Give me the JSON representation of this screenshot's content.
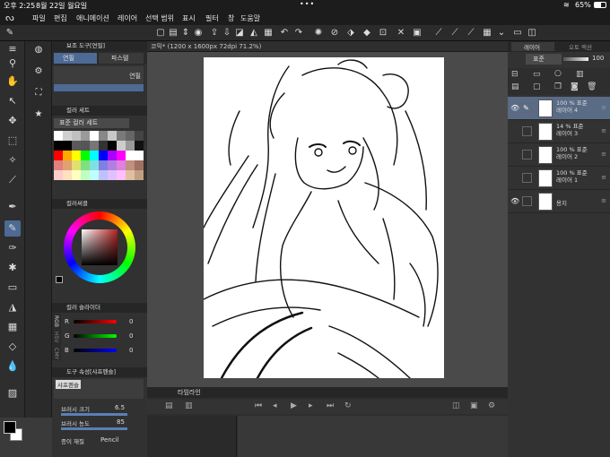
{
  "status": {
    "time": "오후 2:25",
    "date": "8월 22일 월요일",
    "battery": "65%"
  },
  "menu": [
    "파일",
    "편집",
    "애니메이션",
    "레이어",
    "선택 범위",
    "표시",
    "필터",
    "창",
    "도움말"
  ],
  "left_panel": {
    "subtool_title": "보조 도구[연필]",
    "tab_pencil": "연필",
    "tab_pastel": "파스텔",
    "brush_name": "연필",
    "color_set_title": "컬러 세트",
    "color_set_name": "표준 컬러 세트",
    "color_circle_title": "컬러써클",
    "color_slider_title": "컬러 슬라이더",
    "rgb": [
      {
        "ch": "R",
        "val": "0"
      },
      {
        "ch": "G",
        "val": "0"
      },
      {
        "ch": "B",
        "val": "0"
      }
    ],
    "rgb_tab": "RGB",
    "hsv_tab": "HSV",
    "cmy_tab": "CMY",
    "tool_prop_title": "도구 속성[샤프펜슬]",
    "tool_prop_brush": "샤프펜슬",
    "brush_size_label": "브러시 크기",
    "brush_size_value": "6.5",
    "brush_density_label": "브러시 농도",
    "brush_density_value": "85",
    "paper_texture_label": "종이 재질",
    "paper_texture_value": "Pencil",
    "swatches": [
      "#ffffff",
      "#d0d0d0",
      "#c0c0c0",
      "#9a9a9a",
      "#ffffff",
      "#888888",
      "#c8c8c8",
      "#7a7a7a",
      "#666666",
      "#444444",
      "#000000",
      "#000000",
      "#5a5a5a",
      "#555555",
      "#777777",
      "#333333",
      "#000000",
      "#cccccc",
      "#999999",
      "#111111",
      "#ff0000",
      "#ffaa00",
      "#ffff00",
      "#00ff00",
      "#00ffff",
      "#0000ff",
      "#aa00ff",
      "#ff00ff",
      "#ffffff",
      "#ffffff",
      "#e08080",
      "#e0a070",
      "#e0e070",
      "#80e080",
      "#80e0e0",
      "#8080e0",
      "#b080e0",
      "#e080e0",
      "#c09080",
      "#a07060",
      "#ffcccc",
      "#ffe0c0",
      "#ffffc0",
      "#c0ffc0",
      "#c0ffff",
      "#c0c0ff",
      "#e0c0ff",
      "#ffc0ff",
      "#e0c0a0",
      "#c0a080"
    ],
    "hue_ring_values": {
      "sv_color": "#b22222"
    }
  },
  "canvas": {
    "tab_title": "코믹* (1200 x 1600px 72dpi 71.2%)"
  },
  "timeline": {
    "title": "타임라인"
  },
  "right_panel": {
    "tab_layer": "레이어",
    "tab_other": "오토 액션",
    "blend_mode": "표준",
    "opacity": "100",
    "layers": [
      {
        "name": "레이어 4",
        "info": "100 % 표준",
        "visible": true,
        "selected": true,
        "pen": true
      },
      {
        "name": "레이어 3",
        "info": "14 % 표준",
        "visible": false,
        "selected": false,
        "pen": false
      },
      {
        "name": "레이어 2",
        "info": "100 % 표준",
        "visible": false,
        "selected": false,
        "pen": false
      },
      {
        "name": "레이어 1",
        "info": "100 % 표준",
        "visible": false,
        "selected": false,
        "pen": false
      },
      {
        "name": "용지",
        "info": "",
        "visible": true,
        "selected": false,
        "pen": false
      }
    ]
  }
}
